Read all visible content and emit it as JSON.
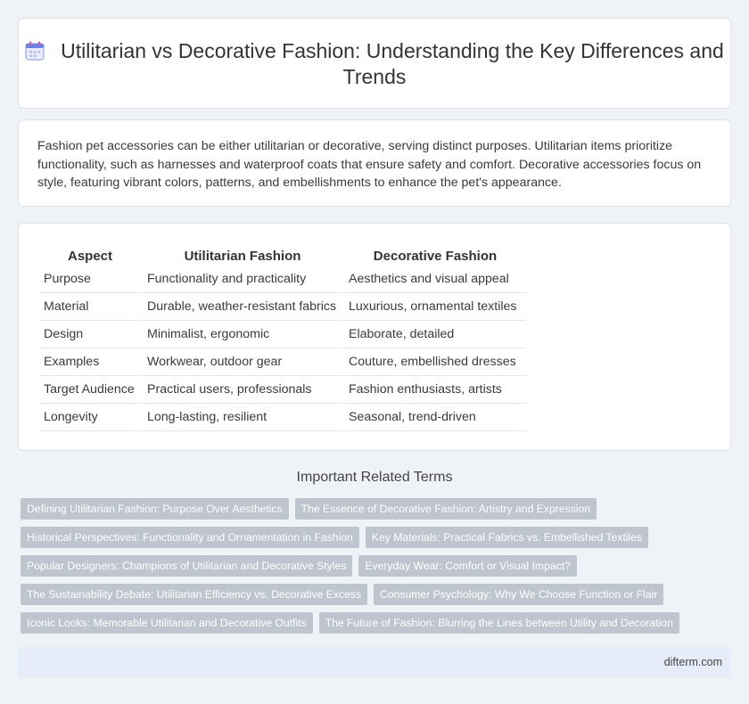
{
  "header": {
    "title": "Utilitarian vs Decorative Fashion: Understanding the Key Differences and Trends",
    "icon": "calendar-icon"
  },
  "intro": {
    "text": "Fashion pet accessories can be either utilitarian or decorative, serving distinct purposes. Utilitarian items prioritize functionality, such as harnesses and waterproof coats that ensure safety and comfort. Decorative accessories focus on style, featuring vibrant colors, patterns, and embellishments to enhance the pet's appearance."
  },
  "table": {
    "headers": [
      "Aspect",
      "Utilitarian Fashion",
      "Decorative Fashion"
    ],
    "rows": [
      [
        "Purpose",
        "Functionality and practicality",
        "Aesthetics and visual appeal"
      ],
      [
        "Material",
        "Durable, weather-resistant fabrics",
        "Luxurious, ornamental textiles"
      ],
      [
        "Design",
        "Minimalist, ergonomic",
        "Elaborate, detailed"
      ],
      [
        "Examples",
        "Workwear, outdoor gear",
        "Couture, embellished dresses"
      ],
      [
        "Target Audience",
        "Practical users, professionals",
        "Fashion enthusiasts, artists"
      ],
      [
        "Longevity",
        "Long-lasting, resilient",
        "Seasonal, trend-driven"
      ]
    ]
  },
  "related": {
    "title": "Important Related Terms",
    "tags": [
      [
        "Defining Utilitarian Fashion: Purpose Over Aesthetics",
        "The Essence of Decorative Fashion: Artistry and Expression"
      ],
      [
        "Historical Perspectives: Functionality and Ornamentation in Fashion",
        "Key Materials: Practical Fabrics vs. Embellished Textiles"
      ],
      [
        "Popular Designers: Champions of Utilitarian and Decorative Styles",
        "Everyday Wear: Comfort or Visual Impact?"
      ],
      [
        "The Sustainability Debate: Utilitarian Efficiency vs. Decorative Excess",
        "Consumer Psychology: Why We Choose Function or Flair"
      ],
      [
        "Iconic Looks: Memorable Utilitarian and Decorative Outfits",
        "The Future of Fashion: Blurring the Lines between Utility and Decoration"
      ]
    ]
  },
  "footer": {
    "site": "difterm.com"
  },
  "colors": {
    "tag_bg": "#bfc5cf",
    "footer_bg": "#e6edf8",
    "page_bg": "#eff2f7"
  }
}
